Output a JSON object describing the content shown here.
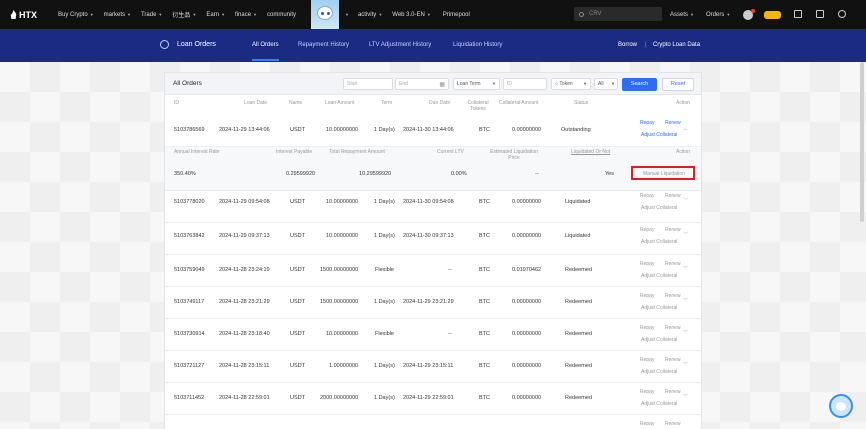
{
  "topnav": {
    "logo": "HTX",
    "items": [
      "Buy Crypto",
      "markets",
      "Trade",
      "衍生品",
      "Earn",
      "finace",
      "community",
      "activity",
      "Web 3.0-EN",
      "Primepool"
    ],
    "search_placeholder": "CRV",
    "assets": "Assets",
    "orders": "Orders",
    "vip_badge": "",
    "icons": [
      "avatar-icon",
      "notification-icon",
      "download-icon",
      "settings-icon"
    ]
  },
  "subnav": {
    "title": "Loan Orders",
    "tabs": [
      "All Orders",
      "Repayment History",
      "LTV Adjustment History",
      "Liquidation History"
    ],
    "borrow": "Borrow",
    "crypto_loan_data": "Crypto Loan Data"
  },
  "panel": {
    "title": "All Orders",
    "start_placeholder": "Start",
    "end_placeholder": "End",
    "loan_term": "Loan Term",
    "id_placeholder": "ID",
    "token": "Token",
    "all": "All",
    "search": "Search",
    "reset": "Reset"
  },
  "headers": {
    "id": "ID",
    "loan_date": "Loan Date",
    "name": "Name",
    "loan_amount": "Loan Amount",
    "term": "Term",
    "due_date": "Due Date",
    "collateral_tokens": "Collateral Tokens",
    "collateral_amount": "Collateral Amount",
    "status": "Status",
    "action": "Action"
  },
  "actions": {
    "repay": "Repay",
    "renew": "Renew",
    "adjust_collateral": "Adjust Collateral"
  },
  "expanded": {
    "headers": {
      "interest_rate": "Annual Interest Rate",
      "interest_payable": "Interest Payable",
      "total_repayment": "Total Repayment Amount",
      "current_ltv": "Current LTV",
      "est_liquidation": "Estimated Liquidation Price",
      "liquidated_or_not": "Liquidated Or Not",
      "action": "Action"
    },
    "values": {
      "interest_rate": "350.40%",
      "interest_payable": "0.29599920",
      "total_repayment": "10.29599920",
      "current_ltv": "0.00%",
      "est_liquidation": "--",
      "liquidated_or_not": "Yes",
      "action": "Manual Liquidation"
    }
  },
  "rows": [
    {
      "id": "5103786569",
      "loan_date": "2024-11-29 13:44:06",
      "name": "USDT",
      "loan_amount": "10.00000000",
      "term": "1 Day(s)",
      "due_date": "2024-11-30 13:44:06",
      "token": "BTC",
      "collateral": "0.00000000",
      "status": "Outstanding"
    },
    {
      "id": "5103778020",
      "loan_date": "2024-11-29 09:54:08",
      "name": "USDT",
      "loan_amount": "10.00000000",
      "term": "1 Day(s)",
      "due_date": "2024-11-30 09:54:08",
      "token": "BTC",
      "collateral": "0.00000000",
      "status": "Liquidated"
    },
    {
      "id": "5103763842",
      "loan_date": "2024-11-29 09:37:13",
      "name": "USDT",
      "loan_amount": "10.00000000",
      "term": "1 Day(s)",
      "due_date": "2024-11-30 09:37:13",
      "token": "BTC",
      "collateral": "0.00000000",
      "status": "Liquidated"
    },
    {
      "id": "5103759049",
      "loan_date": "2024-11-28 23:24:19",
      "name": "USDT",
      "loan_amount": "1500.00000000",
      "term": "Flexible",
      "due_date": "--",
      "token": "BTC",
      "collateral": "0.01970462",
      "status": "Redeemed"
    },
    {
      "id": "5103749117",
      "loan_date": "2024-11-28 23:21:29",
      "name": "USDT",
      "loan_amount": "1500.00000000",
      "term": "1 Day(s)",
      "due_date": "2024-11-29 23:21:29",
      "token": "BTC",
      "collateral": "0.00000000",
      "status": "Redeemed"
    },
    {
      "id": "5103730914",
      "loan_date": "2024-11-28 23:18:40",
      "name": "USDT",
      "loan_amount": "10.00000000",
      "term": "Flexible",
      "due_date": "--",
      "token": "BTC",
      "collateral": "0.00000000",
      "status": "Redeemed"
    },
    {
      "id": "5103721127",
      "loan_date": "2024-11-28 23:15:11",
      "name": "USDT",
      "loan_amount": "1.00000000",
      "term": "1 Day(s)",
      "due_date": "2024-11-29 23:15:11",
      "token": "BTC",
      "collateral": "0.00000000",
      "status": "Redeemed"
    },
    {
      "id": "5103711452",
      "loan_date": "2024-11-28 22:59:01",
      "name": "USDT",
      "loan_amount": "2000.00000000",
      "term": "1 Day(s)",
      "due_date": "2024-11-29 22:59:01",
      "token": "BTC",
      "collateral": "0.00000000",
      "status": "Redeemed"
    }
  ]
}
